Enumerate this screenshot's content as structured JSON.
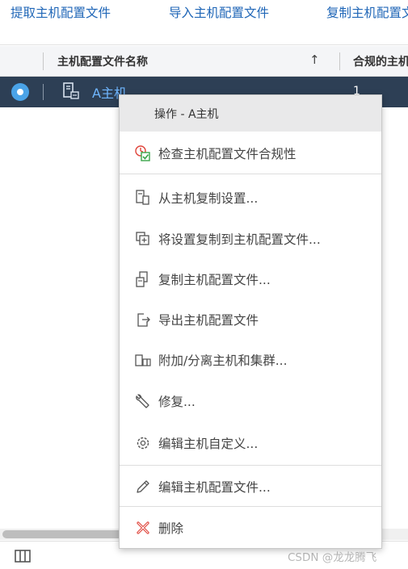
{
  "toolbar": {
    "extract_label": "提取主机配置文件",
    "import_label": "导入主机配置文件",
    "copy_label": "复制主机配置文件"
  },
  "table": {
    "columns": [
      "主机配置文件名称",
      "合规的主机"
    ],
    "sort_indicator": "↑",
    "rows": [
      {
        "name": "A主机",
        "compliant": "1",
        "selected": true
      }
    ]
  },
  "context_menu": {
    "title": "操作 - A主机",
    "items": [
      {
        "label": "检查主机配置文件合规性",
        "icon": "compliance-check-icon"
      },
      {
        "label": "从主机复制设置...",
        "icon": "copy-from-host-icon"
      },
      {
        "label": "将设置复制到主机配置文件...",
        "icon": "copy-to-profile-icon"
      },
      {
        "label": "复制主机配置文件...",
        "icon": "duplicate-profile-icon"
      },
      {
        "label": "导出主机配置文件",
        "icon": "export-icon"
      },
      {
        "label": "附加/分离主机和集群...",
        "icon": "attach-detach-icon"
      },
      {
        "label": "修复...",
        "icon": "wrench-icon"
      },
      {
        "label": "编辑主机自定义...",
        "icon": "customize-gear-icon"
      },
      {
        "label": "编辑主机配置文件...",
        "icon": "pencil-icon"
      },
      {
        "label": "删除",
        "icon": "delete-x-icon"
      }
    ]
  },
  "footer": {
    "watermark": "CSDN @龙龙腾飞"
  },
  "colors": {
    "link": "#1f66b7",
    "selected_row": "#2d3f55",
    "radio": "#4aa3e8",
    "delete_icon": "#e0443a",
    "compliance_icon_check": "#3aa64a"
  }
}
